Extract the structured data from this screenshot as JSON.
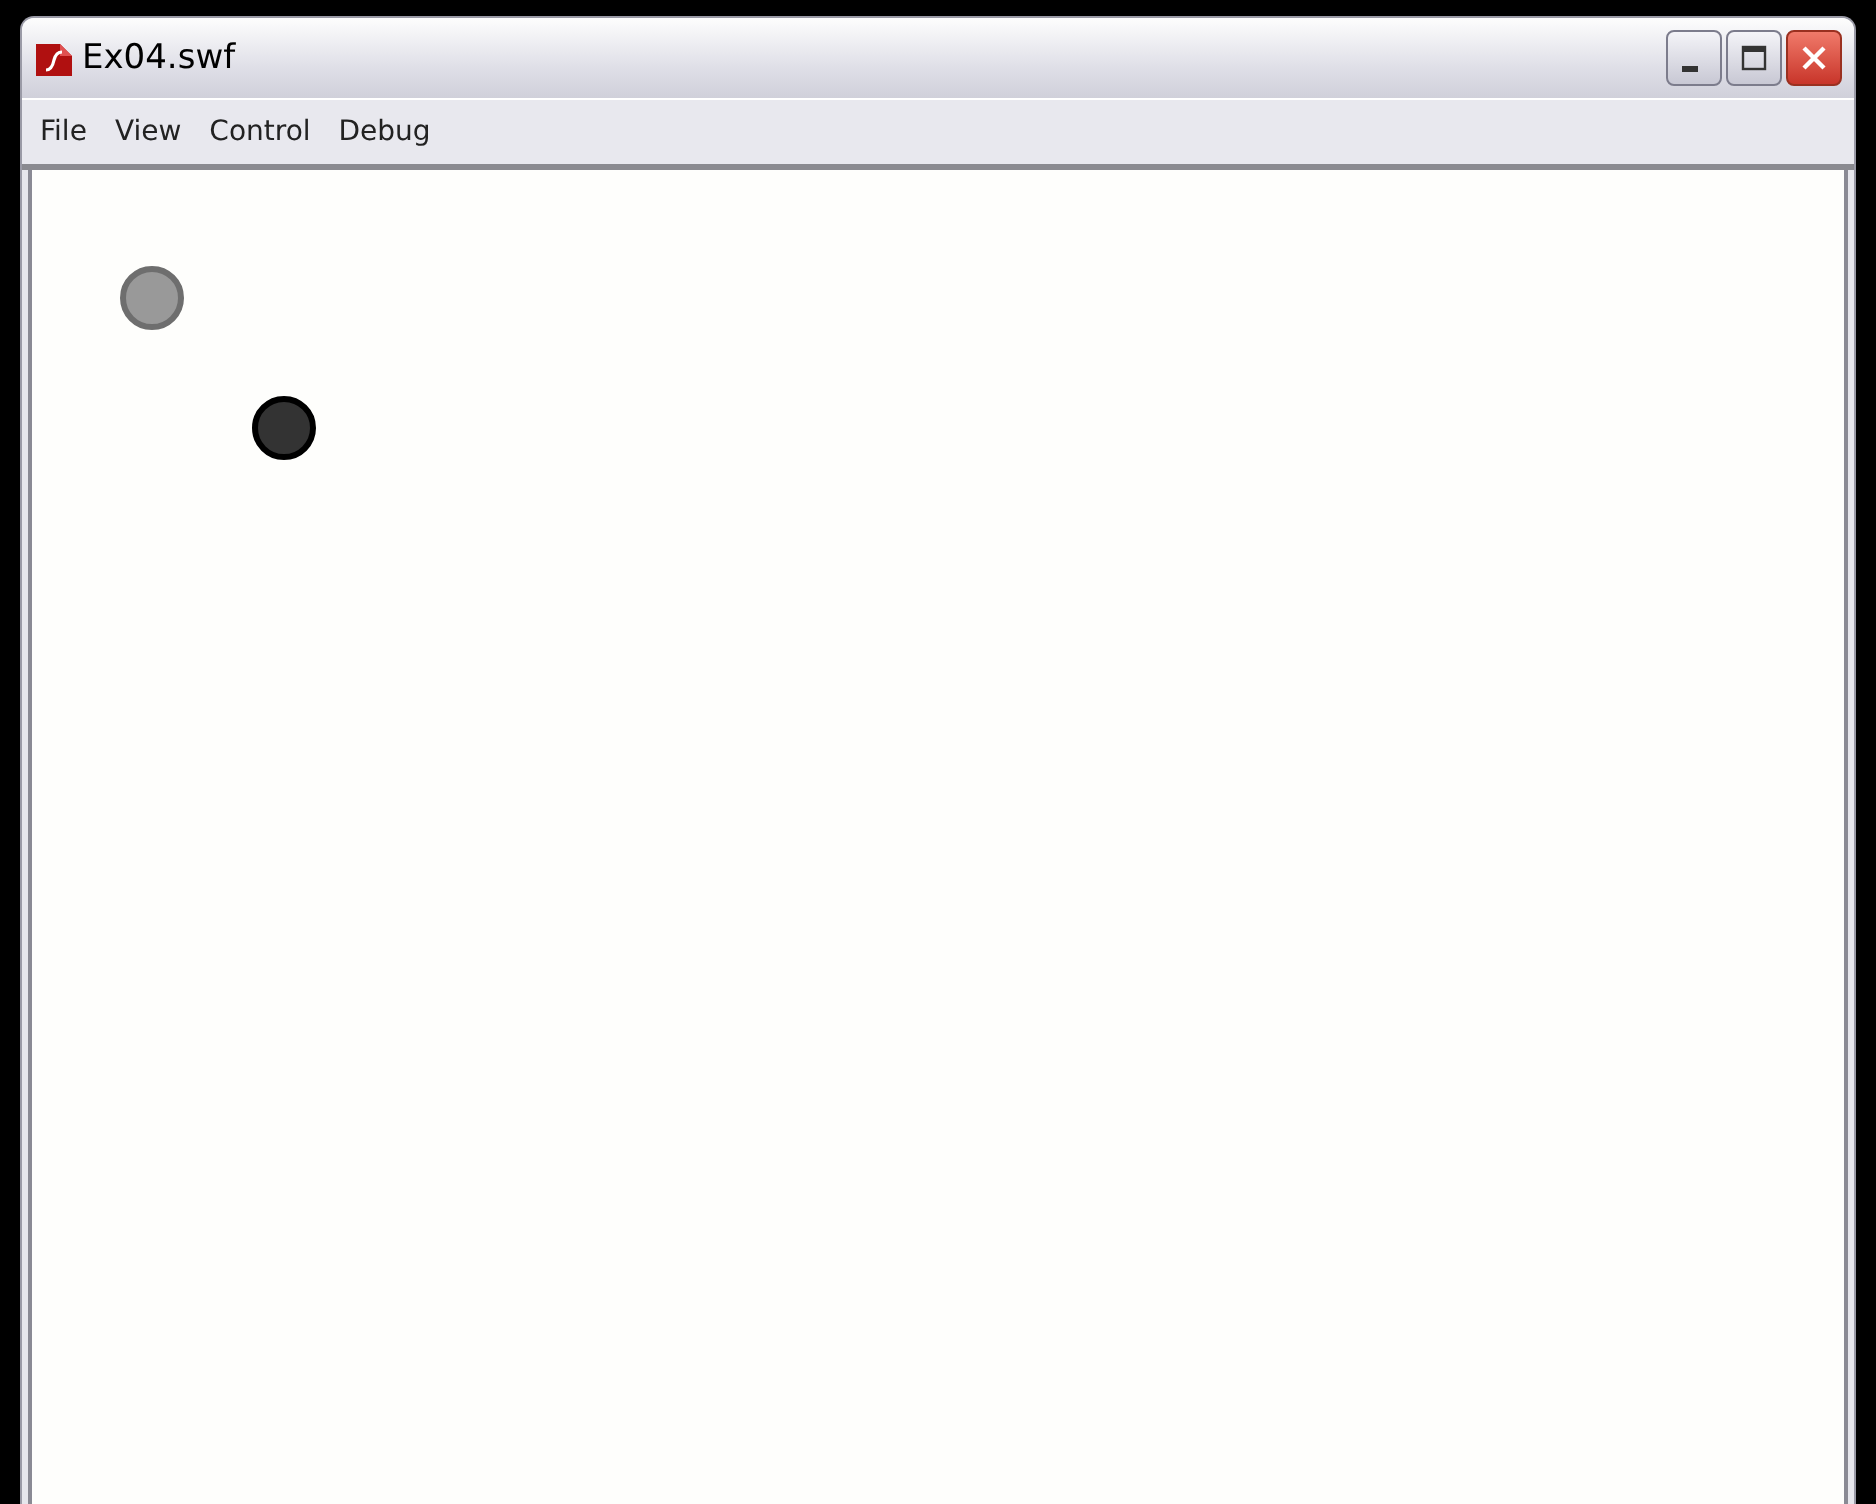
{
  "window": {
    "title": "Ex04.swf"
  },
  "menu": [
    "File",
    "View",
    "Control",
    "Debug"
  ],
  "stage": {
    "balls": [
      {
        "color": "#999999"
      },
      {
        "color": "#333333"
      }
    ]
  }
}
